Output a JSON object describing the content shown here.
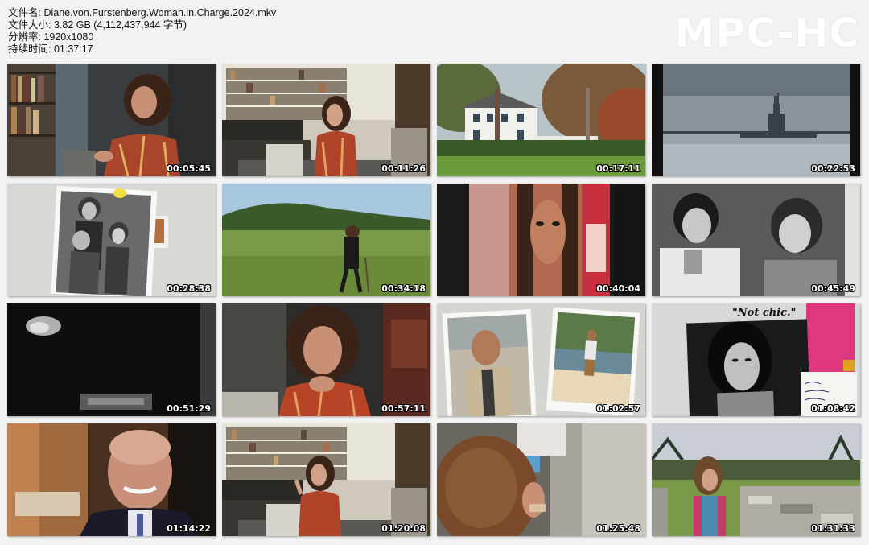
{
  "file_info": {
    "filename_line": "文件名: Diane.von.Furstenberg.Woman.in.Charge.2024.mkv",
    "size_line": "文件大小: 3.82 GB (4,112,437,944 字节)",
    "resolution_line": "分辨率: 1920x1080",
    "duration_line": "持续时间: 01:37:17"
  },
  "logo": "MPC-HC",
  "thumbnails": [
    {
      "time": "00:05:45",
      "scene": "woman-interview-bookshelf"
    },
    {
      "time": "00:11:26",
      "scene": "woman-seated-library-room"
    },
    {
      "time": "00:17:11",
      "scene": "white-house-garden"
    },
    {
      "time": "00:22:53",
      "scene": "statue-of-liberty-water"
    },
    {
      "time": "00:28:38",
      "scene": "family-photo-print"
    },
    {
      "time": "00:34:18",
      "scene": "woman-walking-field"
    },
    {
      "time": "00:40:04",
      "scene": "face-collage-print"
    },
    {
      "time": "00:45:49",
      "scene": "two-men-bw-photo"
    },
    {
      "time": "00:51:29",
      "scene": "dark-bw-footage"
    },
    {
      "time": "00:57:11",
      "scene": "woman-interview-closeup"
    },
    {
      "time": "01:02:57",
      "scene": "two-vintage-photos"
    },
    {
      "time": "01:08:42",
      "scene": "not-chic-magazine-collage"
    },
    {
      "time": "01:14:22",
      "scene": "smiling-man-interview"
    },
    {
      "time": "01:20:08",
      "scene": "woman-seated-library-room-2"
    },
    {
      "time": "01:25:48",
      "scene": "hands-curly-hair-closeup"
    },
    {
      "time": "01:31:33",
      "scene": "woman-outdoors-stone-wall"
    }
  ],
  "collage_text": "\"Not chic.\""
}
